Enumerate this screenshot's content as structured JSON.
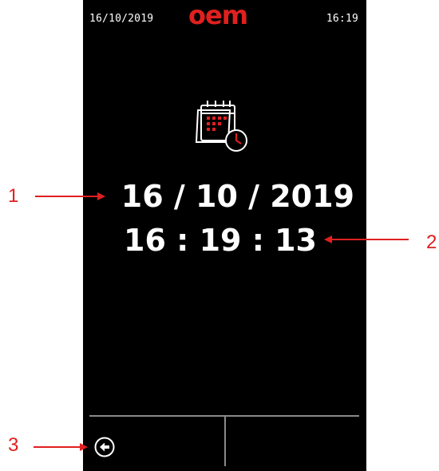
{
  "status_bar": {
    "date": "16/10/2019",
    "logo": "oem",
    "time": "16:19"
  },
  "main": {
    "icon": "calendar-clock-icon",
    "date_value": "16 / 10 / 2019",
    "time_value": "16 : 19 : 13"
  },
  "footer": {
    "back_icon": "back-arrow-icon"
  },
  "annotations": [
    {
      "label": "1",
      "target": "date"
    },
    {
      "label": "2",
      "target": "time"
    },
    {
      "label": "3",
      "target": "back-button"
    }
  ],
  "colors": {
    "screen_bg": "#000000",
    "brand": "#e0201f",
    "text": "#ffffff",
    "divider": "#8a8a8a",
    "annotation": "#e0201f"
  }
}
